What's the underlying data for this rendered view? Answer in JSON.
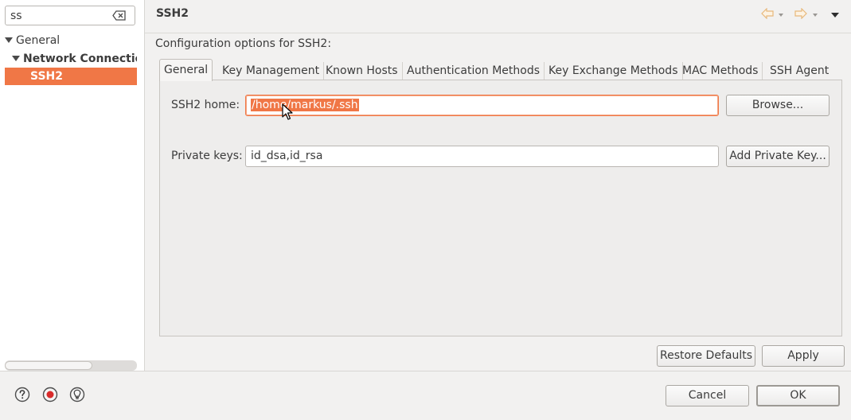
{
  "filter": {
    "value": "ss"
  },
  "tree": {
    "general": "General",
    "network": "Network Connection",
    "ssh2": "SSH2"
  },
  "page": {
    "title": "SSH2",
    "config_label": "Configuration options for SSH2:"
  },
  "tabs": [
    "General",
    "Key Management",
    "Known Hosts",
    "Authentication Methods",
    "Key Exchange Methods",
    "MAC Methods",
    "SSH Agent"
  ],
  "general_tab": {
    "ssh2_home_label": "SSH2 home:",
    "ssh2_home_value": "/home/markus/.ssh",
    "browse_label": "Browse...",
    "private_keys_label": "Private keys:",
    "private_keys_value": "id_dsa,id_rsa",
    "add_key_label": "Add Private Key..."
  },
  "actions": {
    "restore_defaults": "Restore Defaults",
    "apply": "Apply",
    "cancel": "Cancel",
    "ok": "OK"
  },
  "icons": {
    "clear": "clear-filter-icon",
    "back": "back-arrow-icon",
    "forward": "forward-arrow-icon",
    "menu": "view-menu-icon",
    "help": "help-icon",
    "record": "record-icon",
    "tip": "lightbulb-icon"
  },
  "colors": {
    "accent": "#f07746",
    "nav_arrow": "#e8b87a"
  }
}
